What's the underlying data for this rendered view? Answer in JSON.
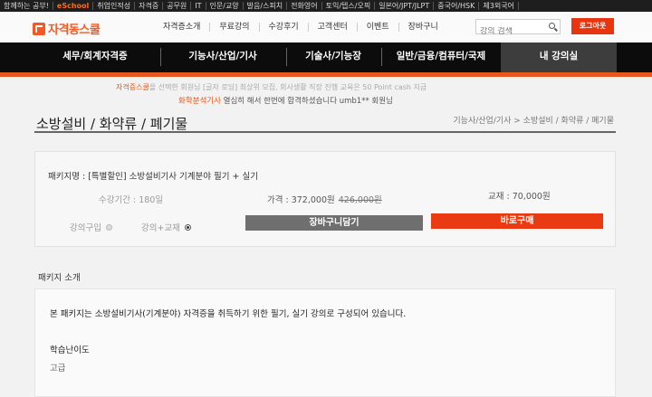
{
  "topstrip": {
    "tagline": "함께하는 공부!",
    "family_site": "eSchool",
    "links": [
      "취업인적성",
      "자격증",
      "공무원",
      "IT",
      "인문/교양",
      "발음/스피치",
      "전화영어",
      "토익/텝스/오픽",
      "일본어/JPT/JLPT",
      "중국어/HSK",
      "제3외국어"
    ]
  },
  "header": {
    "logo_text": "자격동스쿨",
    "nav": [
      "자격증소개",
      "무료강의",
      "수강후기",
      "고객센터",
      "이벤트",
      "장바구니"
    ],
    "search_placeholder": "강의 검색",
    "logout_label": "로그아웃"
  },
  "main_nav": {
    "items": [
      "세무/회계자격증",
      "기능사/산업/기사",
      "기술사/기능장",
      "일반/금융/컴퓨터/국제",
      "내 강의실"
    ],
    "active_index": 4
  },
  "ticker": {
    "line1_prefix": "자격증스쿨",
    "line1_rest": "을 선택한 회원님 [글자 로딩] 최상위 모집, 회사생활 직장 진행 교육은 50 Point cash 지급",
    "line2_highlight": "화학분석기사",
    "line2_rest": " 열심히 해서 한번에 합격하셨습니다 umb1** 회원님"
  },
  "page": {
    "title": "소방설비 / 화약류 / 폐기물",
    "breadcrumb": "기능사/산업/기사 > 소방설비 / 화약류 / 폐기물"
  },
  "package": {
    "name": "패키지명 : [특별할인] 소방설비기사 기계분야 필기 + 실기",
    "period": "수강기간 : 180일",
    "price_label": "가격 : 372,000원",
    "original_price": "426,000원",
    "textbook": "교재 : 70,000원",
    "option_lecture": "강의구입",
    "option_lecture_book": "강의+교재",
    "selected_option": "강의+교재",
    "cart_button": "장바구니담기",
    "buy_button": "바로구매"
  },
  "intro": {
    "heading": "패키지 소개",
    "text": "본 패키지는 소방설비기사(기계분야) 자격증을 취득하기 위한 필기, 실기 강의로 구성되어 있습니다.",
    "difficulty_label": "학습난이도",
    "difficulty_value": "고급"
  },
  "colors": {
    "accent": "#ea3a12",
    "nav_bg": "#0c0c0c",
    "orange_bar": "#e8571c",
    "cart_button": "#6f6f6f"
  }
}
